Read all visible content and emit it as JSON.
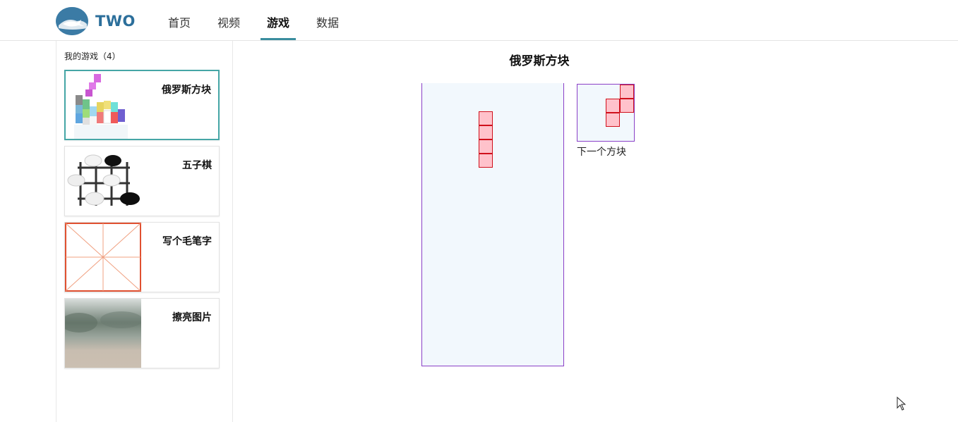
{
  "header": {
    "brand": "TWO",
    "nav": [
      {
        "label": "首页",
        "active": false
      },
      {
        "label": "视频",
        "active": false
      },
      {
        "label": "游戏",
        "active": true
      },
      {
        "label": "数据",
        "active": false
      }
    ]
  },
  "sidebar": {
    "title": "我的游戏（4）",
    "games": [
      {
        "label": "俄罗斯方块",
        "thumb": "tetris-thumbnail",
        "active": true
      },
      {
        "label": "五子棋",
        "thumb": "gomoku-thumbnail",
        "active": false
      },
      {
        "label": "写个毛笔字",
        "thumb": "calligraphy-grid-thumbnail",
        "active": false
      },
      {
        "label": "擦亮图片",
        "thumb": "blurred-photo-thumbnail",
        "active": false
      }
    ]
  },
  "main": {
    "title": "俄罗斯方块",
    "next_label": "下一个方块"
  },
  "colors": {
    "accent": "#46a6a6",
    "brand": "#2c6f9b",
    "board_bg": "#f2f8fd",
    "board_border": "#8a3fc7",
    "block_fill": "#ffc2cb",
    "block_border": "#d0101c"
  }
}
